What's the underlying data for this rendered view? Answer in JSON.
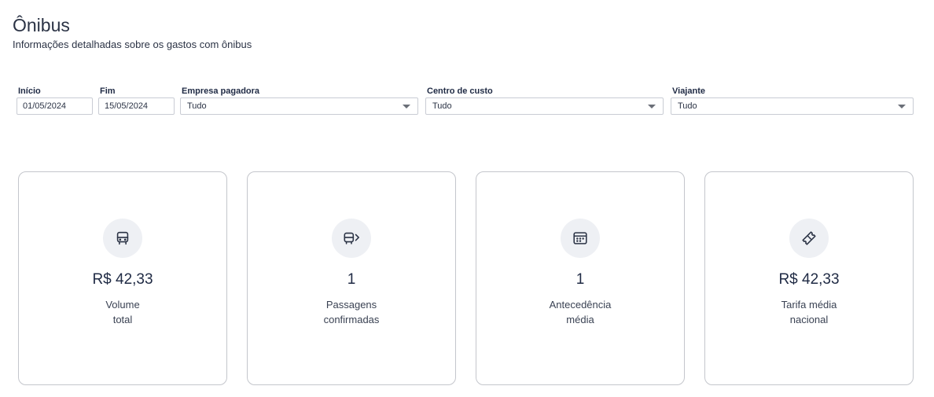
{
  "header": {
    "title": "Ônibus",
    "subtitle": "Informações detalhadas sobre os gastos com ônibus"
  },
  "filters": {
    "start": {
      "label": "Início",
      "value": "01/05/2024"
    },
    "end": {
      "label": "Fim",
      "value": "15/05/2024"
    },
    "company": {
      "label": "Empresa pagadora",
      "value": "Tudo"
    },
    "cost_center": {
      "label": "Centro de custo",
      "value": "Tudo"
    },
    "traveler": {
      "label": "Viajante",
      "value": "Tudo"
    }
  },
  "cards": [
    {
      "icon": "bus-icon",
      "value": "R$ 42,33",
      "label_line1": "Volume",
      "label_line2": "total"
    },
    {
      "icon": "bus-arrow-icon",
      "value": "1",
      "label_line1": "Passagens",
      "label_line2": "confirmadas"
    },
    {
      "icon": "calendar-icon",
      "value": "1",
      "label_line1": "Antecedência",
      "label_line2": "média"
    },
    {
      "icon": "ticket-icon",
      "value": "R$ 42,33",
      "label_line1": "Tarifa média",
      "label_line2": "nacional"
    }
  ]
}
